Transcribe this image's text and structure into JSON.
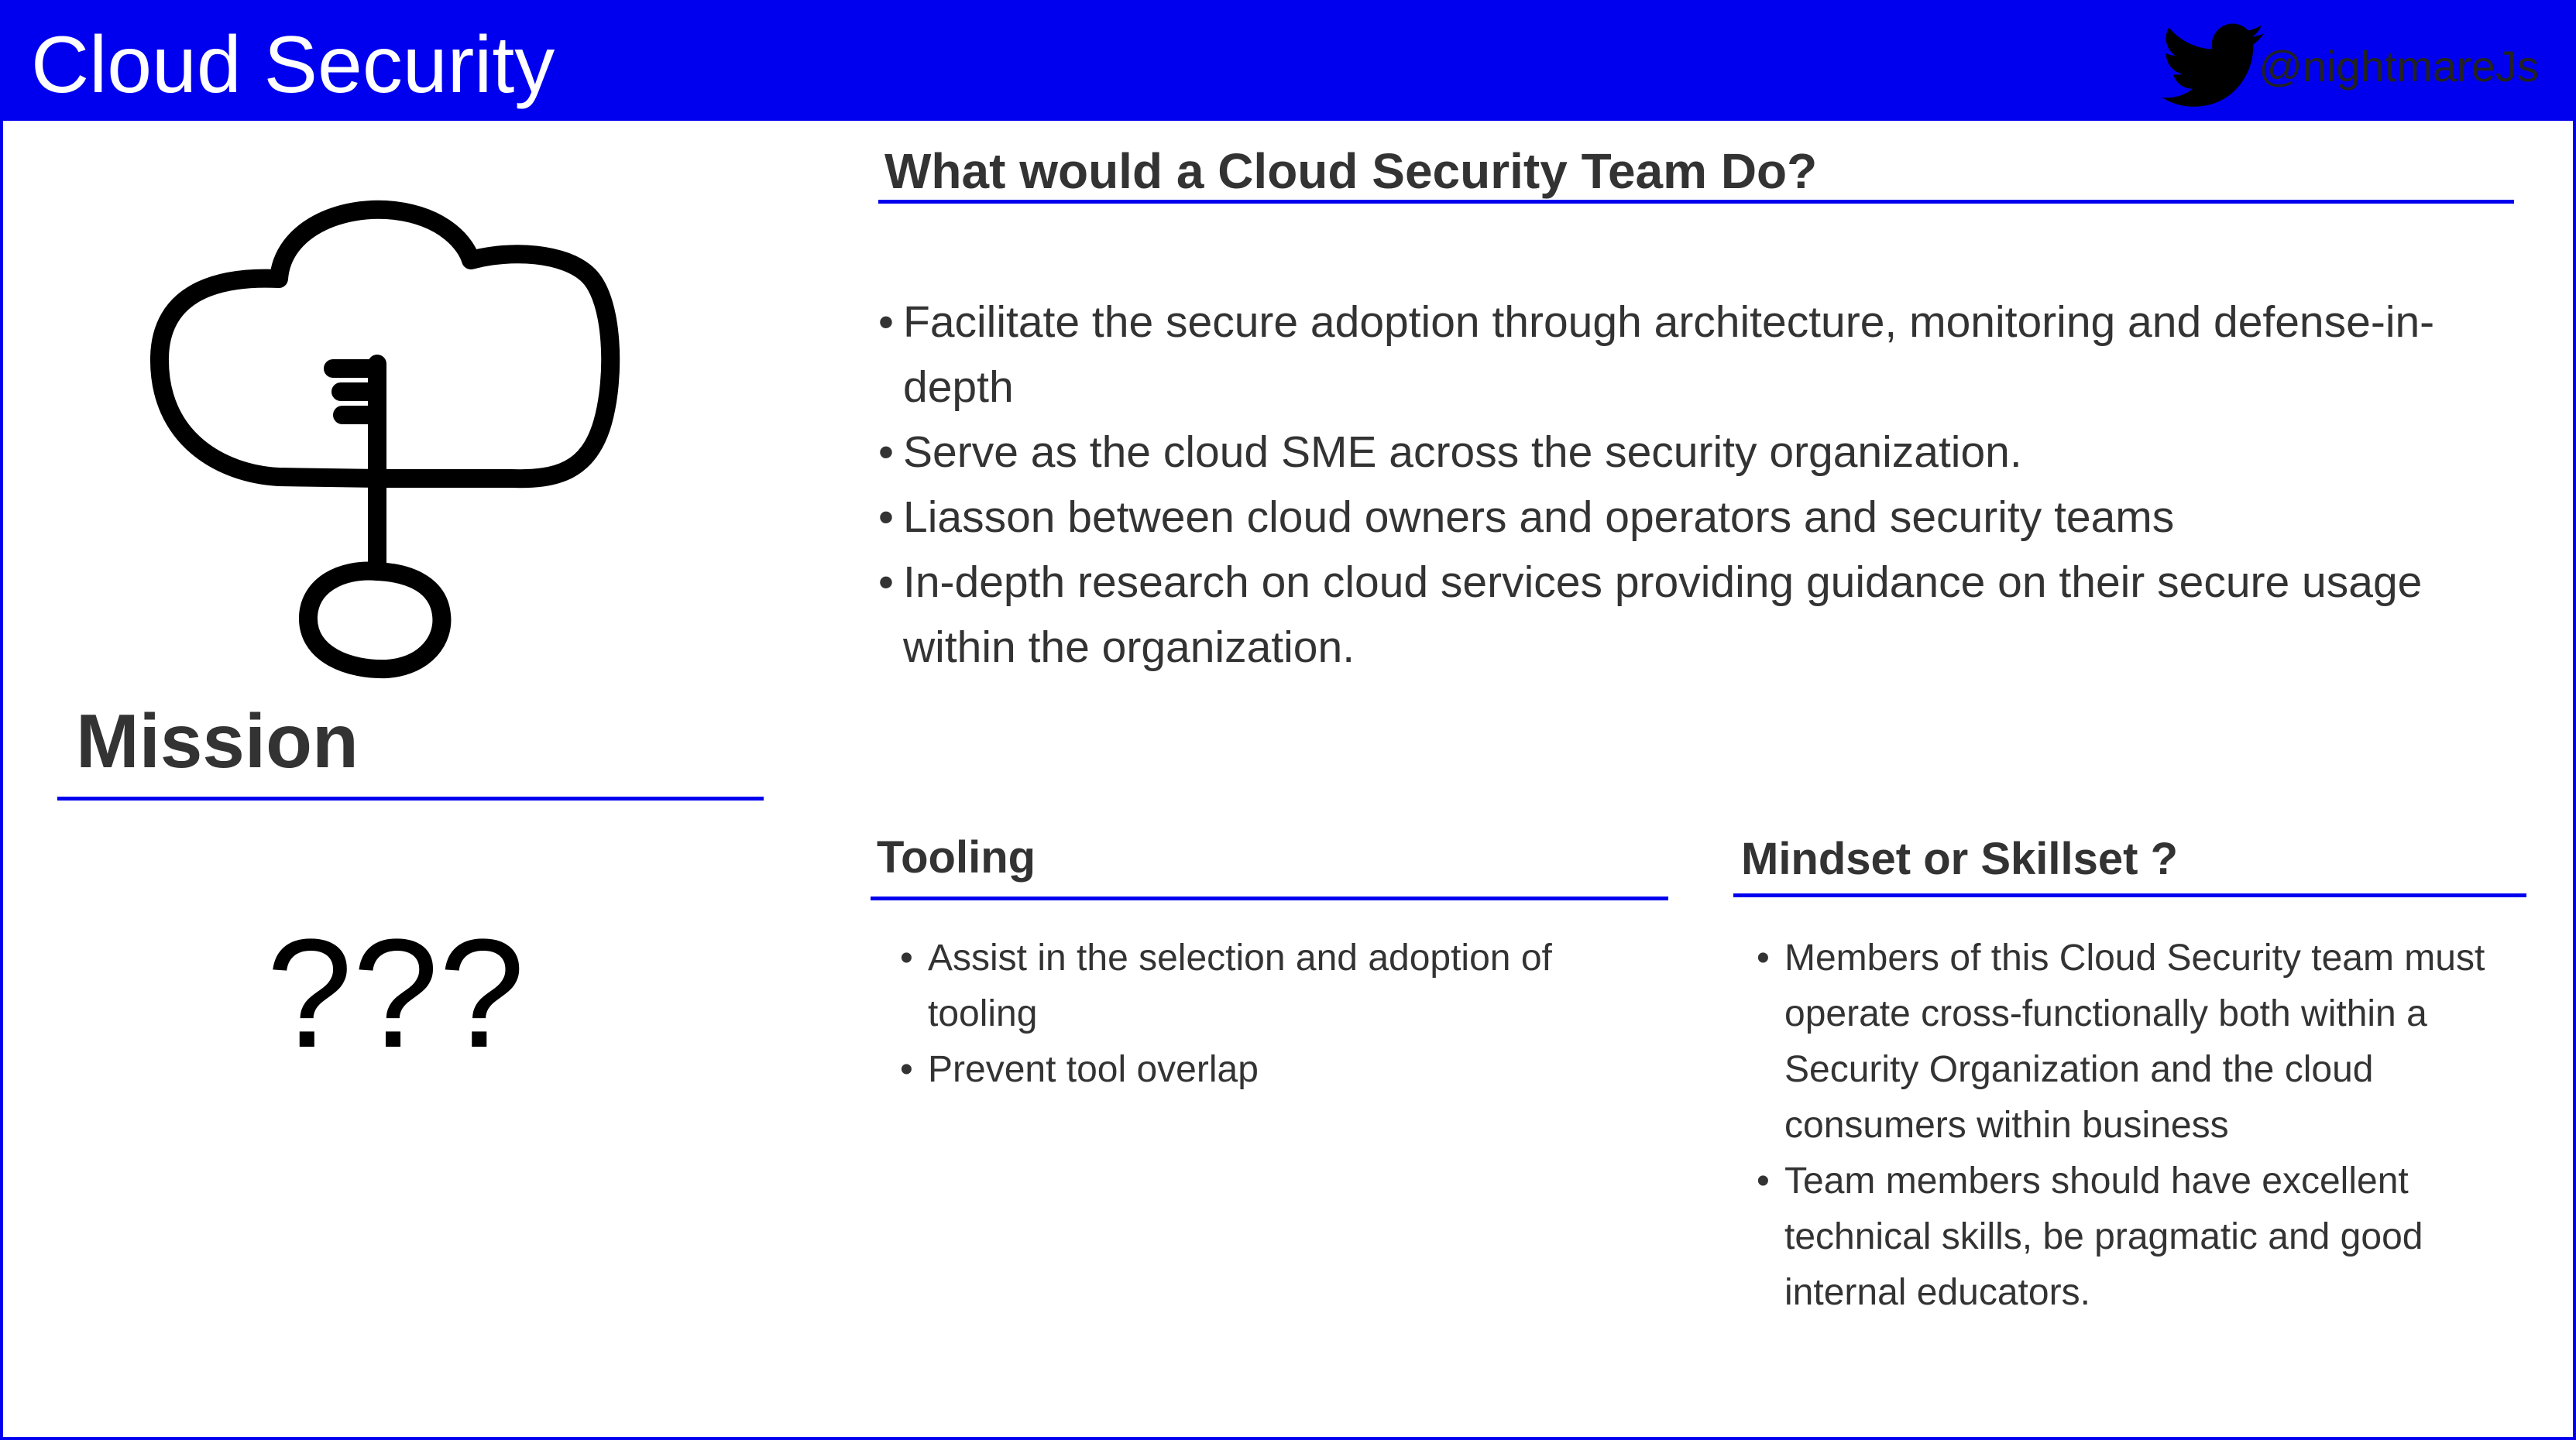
{
  "header": {
    "title": "Cloud Security",
    "handle": "@nightmareJs",
    "brand_color": "#0000ee",
    "icon": "twitter-bird-icon"
  },
  "mission": {
    "icon": "cloud-key-icon",
    "title": "Mission",
    "text": "???"
  },
  "team": {
    "title": "What would a Cloud Security Team Do?",
    "items": [
      "Facilitate the secure adoption through architecture, monitoring and defense-in-depth",
      "Serve as the cloud SME across the security organization.",
      "Liasson between cloud owners and operators and security teams",
      "In-depth research on cloud services providing guidance on their secure usage within the organization."
    ]
  },
  "tooling": {
    "title": "Tooling",
    "items": [
      "Assist in the selection and adoption of tooling",
      "Prevent tool overlap"
    ]
  },
  "mindset": {
    "title": "Mindset or Skillset ?",
    "items": [
      "Members of this Cloud Security team must operate cross-functionally both within a Security Organization and the cloud consumers within business",
      "Team members should have excellent technical skills, be pragmatic and good internal educators."
    ]
  }
}
